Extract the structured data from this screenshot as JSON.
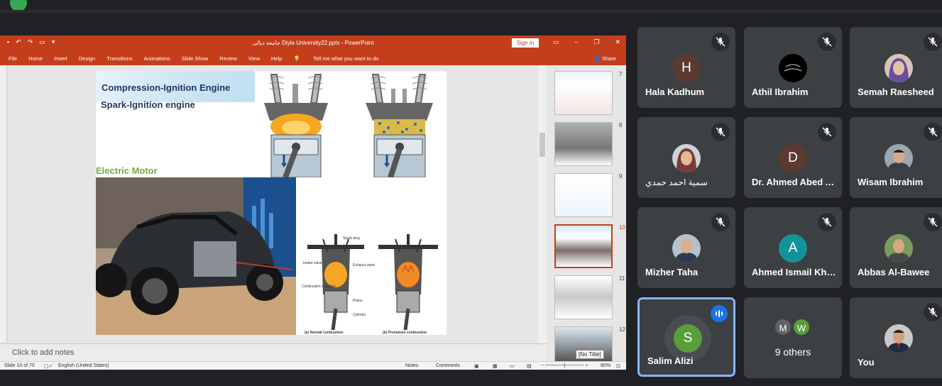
{
  "meeting": {
    "participants": [
      {
        "name": "Hala Kadhum",
        "initial": "H",
        "avatar_color": "#5b3a30",
        "muted": true
      },
      {
        "name": "Athil Ibrahim",
        "muted": true
      },
      {
        "name": "Semah Raesheed",
        "muted": true
      },
      {
        "name": "سمية احمد حمدي",
        "muted": true
      },
      {
        "name": "Dr. Ahmed Abed Alhameed",
        "initial": "D",
        "avatar_color": "#5b3a30",
        "muted": true
      },
      {
        "name": "Wisam Ibrahim",
        "muted": true
      },
      {
        "name": "Mizher Taha",
        "muted": true
      },
      {
        "name": "Ahmed Ismail Khalaf",
        "initial": "A",
        "avatar_color": "#12939a",
        "muted": true
      },
      {
        "name": "Abbas Al-Bawee",
        "muted": true
      },
      {
        "name": "Salim Alizi",
        "initial": "S",
        "avatar_color": "#5a9e3a",
        "speaking": true
      },
      {
        "name": "9 others",
        "initials": [
          "M",
          "W"
        ],
        "mini_colors": [
          "#5f6368",
          "#5a9e3a"
        ]
      },
      {
        "name": "You",
        "muted": true
      }
    ],
    "colors": {
      "speaking_border": "#8ab4f8",
      "tile_bg": "#3c4043",
      "page_bg": "#202124"
    }
  },
  "powerpoint": {
    "document_title": "جامعة ديالى     Diyla University22.pptx - PowerPoint",
    "sign_in": "Sign in",
    "share": "Share",
    "ribbon_tabs": [
      "File",
      "Home",
      "Insert",
      "Design",
      "Transitions",
      "Animations",
      "Slide Show",
      "Review",
      "View",
      "Help",
      "Tell me what you want to do"
    ],
    "slide": {
      "heading_1": "Compression-Ignition Engine",
      "heading_2": "Spark-Ignition engine",
      "heading_3": "Electric Motor",
      "diagram_labels": {
        "spark_plug": "Spark plug",
        "intake": "Intake valve",
        "exhaust": "Exhaust valve",
        "chamber": "Combustion chamber",
        "piston": "Piston",
        "cylinder": "Cylinder",
        "normal": "(a) Normal combustion",
        "premature": "(b) Premature combustion"
      }
    },
    "thumbnail_numbers": [
      "7",
      "8",
      "9",
      "10",
      "11",
      "12"
    ],
    "active_thumbnail": "10",
    "tooltip": "[No Title]",
    "notes_placeholder": "Click to add notes",
    "status": {
      "slide_counter": "Slide 10 of 70",
      "language": "English (United States)",
      "notes": "Notes",
      "comments": "Comments",
      "zoom": "80%"
    },
    "colors": {
      "accent": "#c43e1c",
      "heading": "#1f3864",
      "green": "#70ad47"
    }
  }
}
